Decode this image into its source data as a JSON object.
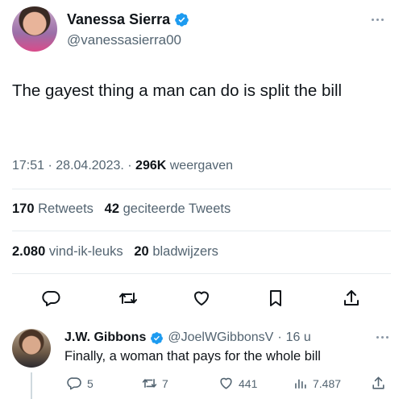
{
  "tweet": {
    "author": {
      "display_name": "Vanessa Sierra",
      "handle": "@vanessasierra00",
      "verified": true,
      "avatar": "avatar-photo"
    },
    "text": "The gayest thing a man can do is split the bill",
    "time": "17:51",
    "date": "28.04.2023.",
    "views_count": "296K",
    "views_label": "weergaven",
    "retweets_count": "170",
    "retweets_label": "Retweets",
    "quotes_count": "42",
    "quotes_label": "geciteerde Tweets",
    "likes_count": "2.080",
    "likes_label": "vind-ik-leuks",
    "bookmarks_count": "20",
    "bookmarks_label": "bladwijzers",
    "actions": [
      "reply-icon",
      "retweet-icon",
      "like-icon",
      "bookmark-icon",
      "share-icon"
    ]
  },
  "reply": {
    "author": {
      "display_name": "J.W. Gibbons",
      "handle": "@JoelWGibbonsV",
      "verified": true
    },
    "age": "16 u",
    "separator": "·",
    "text": "Finally, a woman that pays for the whole bill",
    "replies": "5",
    "retweets": "7",
    "likes": "441",
    "views": "7.487"
  },
  "colors": {
    "text": "#0f1419",
    "secondary": "#536471",
    "verified_blue": "#1d9bf0",
    "divider": "#e6ebee"
  }
}
